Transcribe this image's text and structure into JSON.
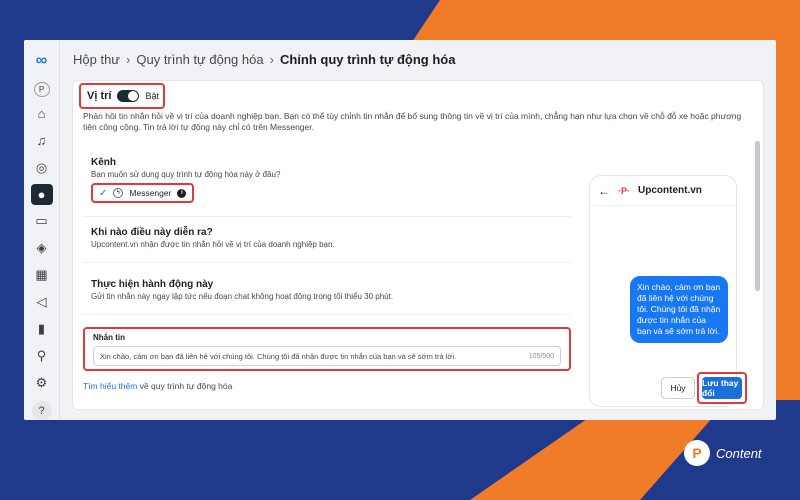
{
  "breadcrumb": {
    "item1": "Hộp thư",
    "sep": "›",
    "item2": "Quy trình tự động hóa",
    "current": "Chỉnh quy trình tự động hóa"
  },
  "trigger": {
    "title": "Vị trí",
    "toggle_label": "Bật",
    "toggle_on": true,
    "description": "Phản hồi tin nhắn hỏi về vị trí của doanh nghiệp bạn. Bạn có thể tùy chỉnh tin nhắn để bổ sung thông tin về vị trí của mình, chẳng hạn như lựa chọn về chỗ đỗ xe hoặc phương tiện công cộng. Tin trả lời tự động này chỉ có trên Messenger."
  },
  "channel": {
    "title": "Kênh",
    "subtitle": "Bạn muốn sử dụng quy trình tự động hóa này ở đâu?",
    "option": "Messenger"
  },
  "when": {
    "title": "Khi nào điều này diễn ra?",
    "subtitle": "Upcontent.vn nhận được tin nhắn hỏi về vị trí của doanh nghiệp bạn."
  },
  "action": {
    "title": "Thực hiện hành động này",
    "subtitle": "Gửi tin nhắn này ngay lập tức nếu đoạn chat không hoạt động trong tối thiểu 30 phút."
  },
  "message": {
    "label": "Nhắn tin",
    "value": "Xin chào, cảm ơn bạn đã liên hệ với chúng tôi. Chúng tôi đã nhận được tin nhắn của bạn và sẽ sớm trả lời.",
    "counter": "105/500"
  },
  "learn_more": {
    "link": "Tìm hiểu thêm",
    "rest": "về quy trình tự động hóa"
  },
  "preview": {
    "page_name": "Upcontent.vn",
    "page_logo": "·P·",
    "bubble": "Xin chào, cảm ơn bạn đã liên hệ với chúng tôi. Chúng tôi đã nhận được tin nhắn của bạn và sẽ sớm trả lời."
  },
  "buttons": {
    "cancel": "Hủy",
    "save": "Lưu thay đổi"
  },
  "watermark": {
    "text": "Content"
  },
  "colors": {
    "accent": "#1877f2",
    "highlight": "#e03a3a",
    "bg_navy": "#1f3a8a",
    "bg_orange": "#f07c2a"
  }
}
